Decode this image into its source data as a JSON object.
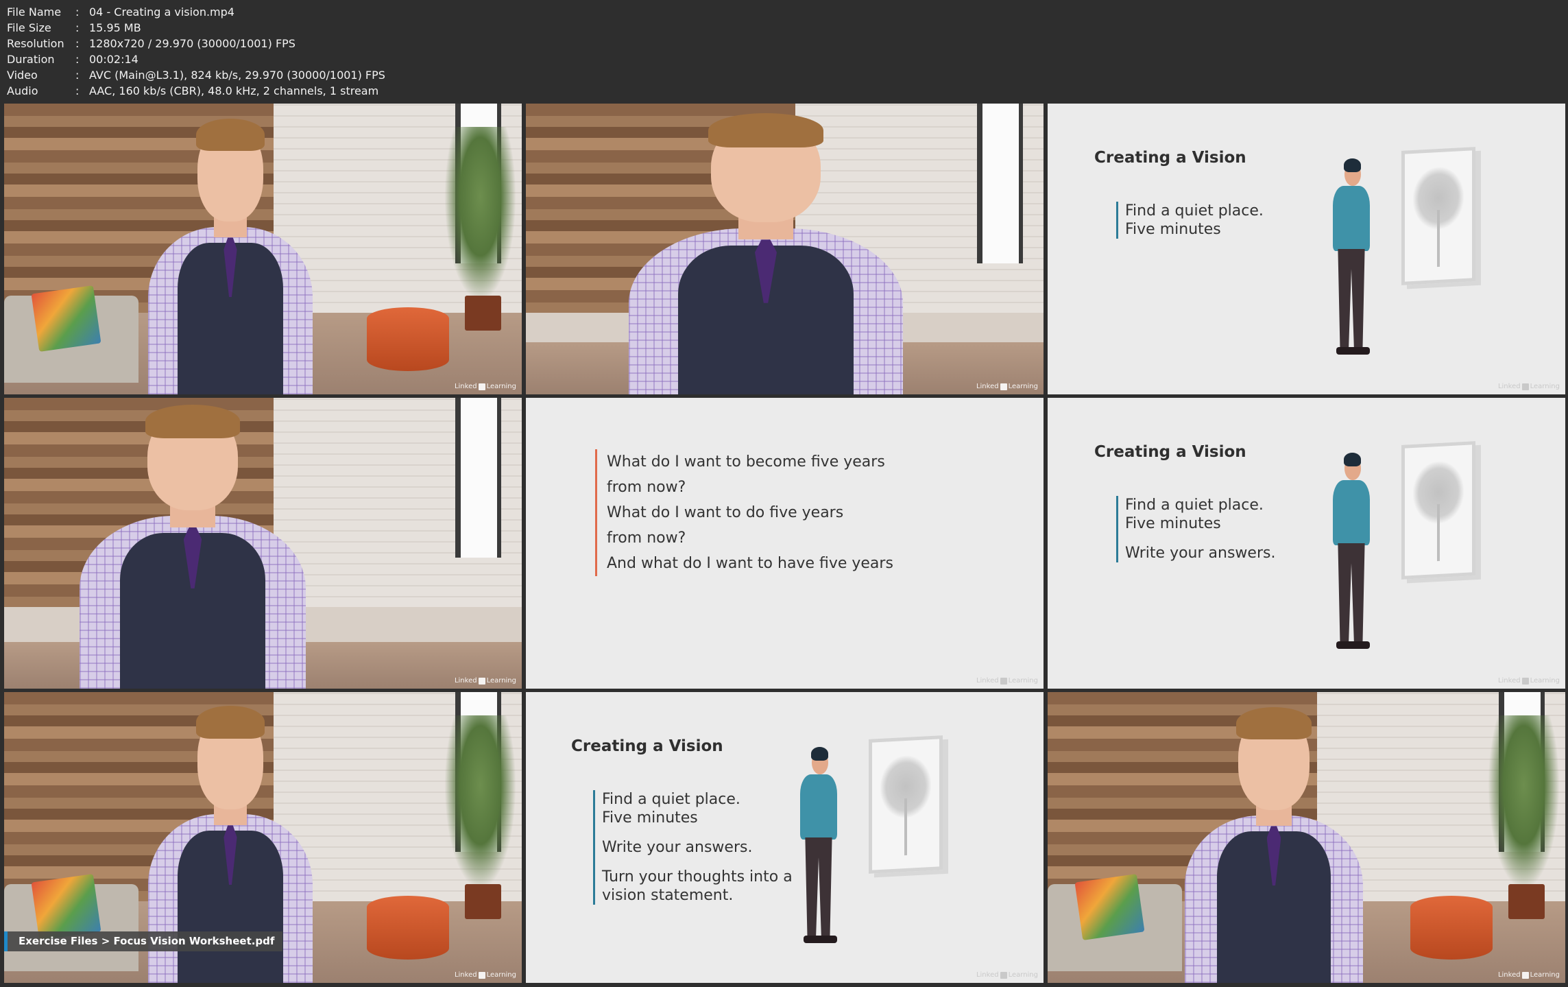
{
  "metadata": [
    {
      "key": "File Name",
      "sep": ":",
      "value": "04 - Creating a vision.mp4"
    },
    {
      "key": "File Size",
      "sep": ":",
      "value": "15.95 MB"
    },
    {
      "key": "Resolution",
      "sep": ":",
      "value": "1280x720 / 29.970 (30000/1001) FPS"
    },
    {
      "key": "Duration",
      "sep": ":",
      "value": "00:02:14"
    },
    {
      "key": "Video",
      "sep": ":",
      "value": "AVC (Main@L3.1), 824 kb/s, 29.970 (30000/1001) FPS"
    },
    {
      "key": "Audio",
      "sep": ":",
      "value": "AAC, 160 kb/s (CBR), 48.0 kHz, 2 channels, 1 stream"
    }
  ],
  "watermark": {
    "left": "Linked",
    "right": "Learning"
  },
  "slides": {
    "title": "Creating a Vision",
    "bullet_1_line_1": "Find a quiet place.",
    "bullet_1_line_2": "Five minutes",
    "bullet_2": "Write your answers.",
    "bullet_3_line_1": "Turn your thoughts into a",
    "bullet_3_line_2": "vision statement."
  },
  "questions": [
    "What do I want to become five years",
    "from now?",
    "What do I want to do five years",
    "from now?",
    "And what do I want to have five years"
  ],
  "exercise_banner": "Exercise Files > Focus Vision Worksheet.pdf",
  "colors": {
    "accent_teal": "#2b7b97",
    "accent_orange": "#e06a4a",
    "banner_blue": "#1f89c8"
  }
}
